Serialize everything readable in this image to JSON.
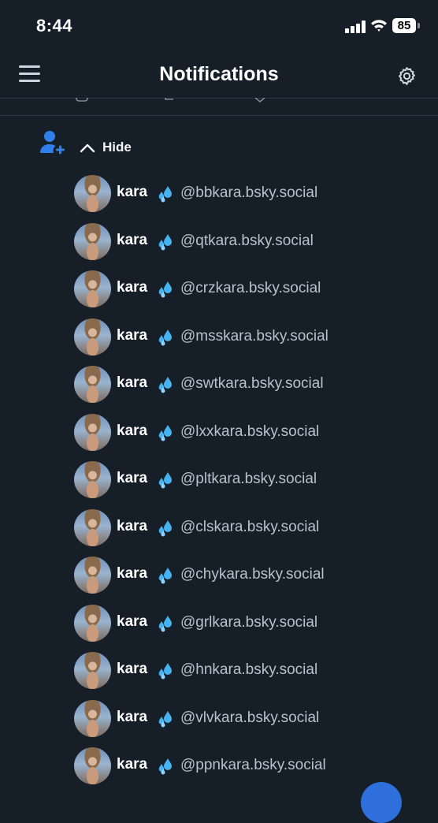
{
  "status_bar": {
    "time": "8:44",
    "battery": "85"
  },
  "header": {
    "title": "Notifications"
  },
  "notification": {
    "hide_label": "Hide",
    "followers": [
      {
        "name": "kara",
        "handle": "@bbkara.bsky.social"
      },
      {
        "name": "kara",
        "handle": "@qtkara.bsky.social"
      },
      {
        "name": "kara",
        "handle": "@crzkara.bsky.social"
      },
      {
        "name": "kara",
        "handle": "@msskara.bsky.social"
      },
      {
        "name": "kara",
        "handle": "@swtkara.bsky.social"
      },
      {
        "name": "kara",
        "handle": "@lxxkara.bsky.social"
      },
      {
        "name": "kara",
        "handle": "@pltkara.bsky.social"
      },
      {
        "name": "kara",
        "handle": "@clskara.bsky.social"
      },
      {
        "name": "kara",
        "handle": "@chykara.bsky.social"
      },
      {
        "name": "kara",
        "handle": "@grlkara.bsky.social"
      },
      {
        "name": "kara",
        "handle": "@hnkara.bsky.social"
      },
      {
        "name": "kara",
        "handle": "@vlvkara.bsky.social"
      },
      {
        "name": "kara",
        "handle": "@ppnkara.bsky.social"
      }
    ]
  },
  "icons": {
    "name_emoji": "sweat-droplets-icon",
    "header_left": "menu-icon",
    "header_right": "settings-gear-icon",
    "notification_type": "person-add-icon"
  },
  "colors": {
    "background": "#161e27",
    "accent": "#2f80ed",
    "muted_text": "#b7c2cd"
  }
}
